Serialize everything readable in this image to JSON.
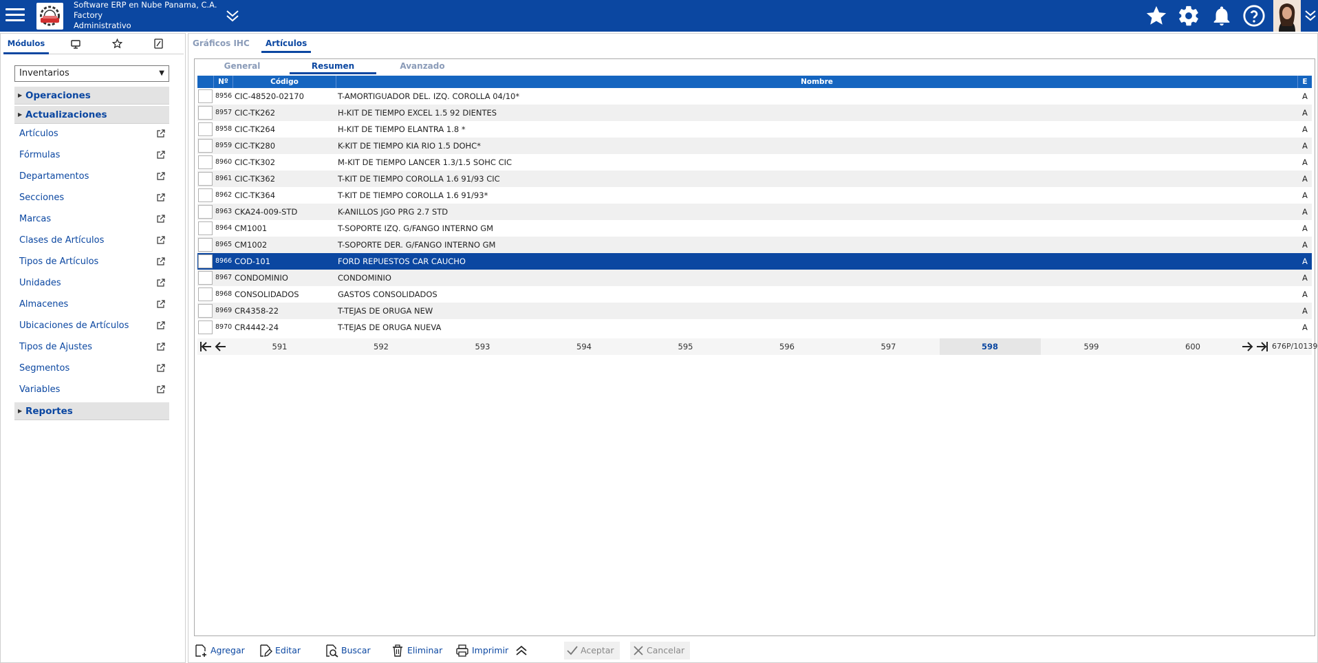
{
  "header": {
    "company": "Software ERP en Nube Panama, C.A.",
    "branch": "Factory",
    "role": "Administrativo"
  },
  "left_panel": {
    "tabs": [
      "Módulos"
    ],
    "selected_module": "Inventarios",
    "sections": {
      "operaciones": "Operaciones",
      "actualizaciones": "Actualizaciones",
      "reportes": "Reportes"
    },
    "items": [
      "Artículos",
      "Fórmulas",
      "Departamentos",
      "Secciones",
      "Marcas",
      "Clases de Artículos",
      "Tipos de Artículos",
      "Unidades",
      "Almacenes",
      "Ubicaciones de Artículos",
      "Tipos de Ajustes",
      "Segmentos",
      "Variables"
    ]
  },
  "main": {
    "tabs": [
      "Gráficos IHC",
      "Artículos"
    ],
    "subtabs": [
      "General",
      "Resumen",
      "Avanzado"
    ],
    "grid": {
      "columns": [
        "Nº",
        "Código",
        "Nombre",
        "E"
      ],
      "rows": [
        {
          "num": "8956",
          "code": "CIC-48520-02170",
          "name": "T-AMORTIGUADOR DEL. IZQ. COROLLA 04/10*",
          "e": "A"
        },
        {
          "num": "8957",
          "code": "CIC-TK262",
          "name": "H-KIT DE TIEMPO EXCEL 1.5 92 DIENTES",
          "e": "A"
        },
        {
          "num": "8958",
          "code": "CIC-TK264",
          "name": "H-KIT DE TIEMPO ELANTRA 1.8 *",
          "e": "A"
        },
        {
          "num": "8959",
          "code": "CIC-TK280",
          "name": "K-KIT DE TIEMPO KIA RIO 1.5 DOHC*",
          "e": "A"
        },
        {
          "num": "8960",
          "code": "CIC-TK302",
          "name": "M-KIT DE TIEMPO LANCER 1.3/1.5 SOHC CIC",
          "e": "A"
        },
        {
          "num": "8961",
          "code": "CIC-TK362",
          "name": "T-KIT DE TIEMPO COROLLA 1.6 91/93 CIC",
          "e": "A"
        },
        {
          "num": "8962",
          "code": "CIC-TK364",
          "name": "T-KIT DE TIEMPO COROLLA 1.6 91/93*",
          "e": "A"
        },
        {
          "num": "8963",
          "code": "CKA24-009-STD",
          "name": "K-ANILLOS JGO PRG 2.7 STD",
          "e": "A"
        },
        {
          "num": "8964",
          "code": "CM1001",
          "name": "T-SOPORTE IZQ. G/FANGO INTERNO GM",
          "e": "A"
        },
        {
          "num": "8965",
          "code": "CM1002",
          "name": "T-SOPORTE DER. G/FANGO INTERNO GM",
          "e": "A"
        },
        {
          "num": "8966",
          "code": "COD-101",
          "name": "FORD REPUESTOS CAR CAUCHO",
          "e": "A"
        },
        {
          "num": "8967",
          "code": "CONDOMINIO",
          "name": "CONDOMINIO",
          "e": "A"
        },
        {
          "num": "8968",
          "code": "CONSOLIDADOS",
          "name": "GASTOS CONSOLIDADOS",
          "e": "A"
        },
        {
          "num": "8969",
          "code": "CR4358-22",
          "name": "T-TEJAS DE ORUGA NEW",
          "e": "A"
        },
        {
          "num": "8970",
          "code": "CR4442-24",
          "name": "T-TEJAS DE ORUGA NUEVA",
          "e": "A"
        }
      ],
      "selected_row": 10
    },
    "pager": {
      "pages": [
        "591",
        "592",
        "593",
        "594",
        "595",
        "596",
        "597",
        "598",
        "599",
        "600"
      ],
      "current": "598",
      "count": "676P/10139R"
    },
    "toolbar": {
      "add": "Agregar",
      "edit": "Editar",
      "search": "Buscar",
      "delete": "Eliminar",
      "print": "Imprimir",
      "accept": "Aceptar",
      "cancel": "Cancelar"
    }
  },
  "colors": {
    "header_bg": "#0b47a1",
    "grid_header_bg": "#1565c0",
    "selected_row_bg": "#0b47a1",
    "link": "#0b47a1"
  }
}
